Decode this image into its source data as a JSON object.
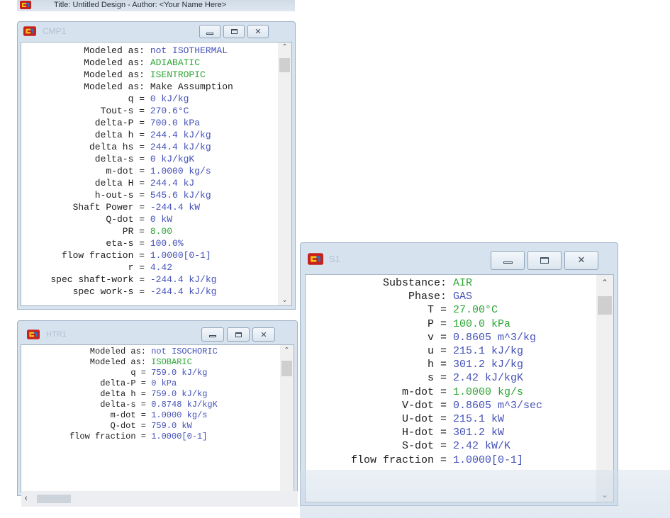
{
  "top_bar": {
    "text": "Title: Untitled Design - Author: <Your Name Here>"
  },
  "windows": {
    "cmp1": {
      "title": "CMP1",
      "rows": [
        {
          "label": "Modeled as:",
          "value": "not ISOTHERMAL",
          "color": "blue"
        },
        {
          "label": "Modeled as:",
          "value": "ADIABATIC",
          "color": "green"
        },
        {
          "label": "Modeled as:",
          "value": "ISENTROPIC",
          "color": "green"
        },
        {
          "label": "Modeled as:",
          "value": "Make Assumption",
          "color": "black"
        },
        {
          "label": "q =",
          "value": "0 kJ/kg",
          "color": "blue"
        },
        {
          "label": "Tout-s =",
          "value": "270.6°C",
          "color": "blue"
        },
        {
          "label": "delta-P =",
          "value": "700.0 kPa",
          "color": "blue"
        },
        {
          "label": "delta h =",
          "value": "244.4 kJ/kg",
          "color": "blue"
        },
        {
          "label": "delta hs =",
          "value": "244.4 kJ/kg",
          "color": "blue"
        },
        {
          "label": "delta-s =",
          "value": "0 kJ/kgK",
          "color": "blue"
        },
        {
          "label": "m-dot =",
          "value": "1.0000 kg/s",
          "color": "blue"
        },
        {
          "label": "delta H =",
          "value": "244.4 kJ",
          "color": "blue"
        },
        {
          "label": "h-out-s =",
          "value": "545.6 kJ/kg",
          "color": "blue"
        },
        {
          "label": "Shaft Power =",
          "value": "-244.4 kW",
          "color": "blue"
        },
        {
          "label": "Q-dot =",
          "value": "0 kW",
          "color": "blue"
        },
        {
          "label": "PR =",
          "value": "8.00",
          "color": "green"
        },
        {
          "label": "eta-s =",
          "value": "100.0%",
          "color": "blue"
        },
        {
          "label": "flow fraction =",
          "value": "1.0000[0-1]",
          "color": "blue"
        },
        {
          "label": "r =",
          "value": "4.42",
          "color": "blue"
        },
        {
          "label": "spec shaft-work =",
          "value": "-244.4 kJ/kg",
          "color": "blue"
        },
        {
          "label": "spec work-s =",
          "value": "-244.4 kJ/kg",
          "color": "blue"
        }
      ]
    },
    "htr1": {
      "title": "HTR1",
      "rows": [
        {
          "label": "Modeled as:",
          "value": "not ISOCHORIC",
          "color": "blue"
        },
        {
          "label": "Modeled as:",
          "value": "ISOBARIC",
          "color": "green"
        },
        {
          "label": "q =",
          "value": "759.0 kJ/kg",
          "color": "blue"
        },
        {
          "label": "delta-P =",
          "value": "0 kPa",
          "color": "blue"
        },
        {
          "label": "delta h =",
          "value": "759.0 kJ/kg",
          "color": "blue"
        },
        {
          "label": "delta-s =",
          "value": "0.8748 kJ/kgK",
          "color": "blue"
        },
        {
          "label": "m-dot =",
          "value": "1.0000 kg/s",
          "color": "blue"
        },
        {
          "label": "Q-dot =",
          "value": "759.0 kW",
          "color": "blue"
        },
        {
          "label": "flow fraction =",
          "value": "1.0000[0-1]",
          "color": "blue"
        }
      ]
    },
    "s1": {
      "title": "S1",
      "rows": [
        {
          "label": "Substance:",
          "value": "AIR",
          "color": "green"
        },
        {
          "label": "Phase:",
          "value": "GAS",
          "color": "blue"
        },
        {
          "label": "T =",
          "value": "27.00°C",
          "color": "green"
        },
        {
          "label": "P =",
          "value": "100.0 kPa",
          "color": "green"
        },
        {
          "label": "v =",
          "value": "0.8605 m^3/kg",
          "color": "blue"
        },
        {
          "label": "u =",
          "value": "215.1 kJ/kg",
          "color": "blue"
        },
        {
          "label": "h =",
          "value": "301.2 kJ/kg",
          "color": "blue"
        },
        {
          "label": "s =",
          "value": "2.42 kJ/kgK",
          "color": "blue"
        },
        {
          "label": "m-dot =",
          "value": "1.0000 kg/s",
          "color": "green"
        },
        {
          "label": "V-dot =",
          "value": "0.8605 m^3/sec",
          "color": "blue"
        },
        {
          "label": "U-dot =",
          "value": "215.1 kW",
          "color": "blue"
        },
        {
          "label": "H-dot =",
          "value": "301.2 kW",
          "color": "blue"
        },
        {
          "label": "S-dot =",
          "value": "2.42 kW/K",
          "color": "blue"
        },
        {
          "label": "flow fraction =",
          "value": "1.0000[0-1]",
          "color": "blue"
        }
      ]
    }
  },
  "icons": {
    "app": "app-icon",
    "minimize": "minimize-icon",
    "maximize": "maximize-icon",
    "close": "close-icon",
    "scroll_up": "scroll-up-arrow-icon",
    "scroll_down": "scroll-down-arrow-icon",
    "scroll_left": "scroll-left-arrow-icon"
  },
  "colors": {
    "value_blue": "#4451b8",
    "value_green": "#2ea535",
    "label_black": "#1c1c1c",
    "frame": "#d6e2ee"
  }
}
